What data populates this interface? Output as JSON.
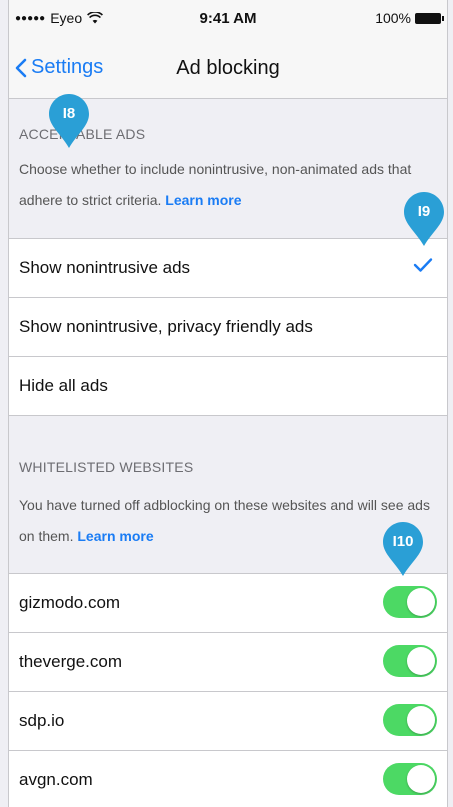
{
  "status_bar": {
    "carrier": "Eyeo",
    "time": "9:41 AM",
    "battery": "100%"
  },
  "nav": {
    "back_label": "Settings",
    "title": "Ad blocking"
  },
  "acceptable_ads": {
    "header": "ACCEPTABLE ADS",
    "description": "Choose whether to include nonintrusive, non-animated ads that adhere to strict criteria.",
    "learn_more": "Learn more",
    "options": [
      {
        "label": "Show nonintrusive ads",
        "selected": true
      },
      {
        "label": "Show nonintrusive, privacy friendly ads",
        "selected": false
      },
      {
        "label": "Hide all ads",
        "selected": false
      }
    ]
  },
  "whitelisted": {
    "header": "WHITELISTED WEBSITES",
    "description": "You have turned off adblocking on these websites and will see ads on them.",
    "learn_more": "Learn more",
    "sites": [
      {
        "domain": "gizmodo.com",
        "enabled": true
      },
      {
        "domain": "theverge.com",
        "enabled": true
      },
      {
        "domain": "sdp.io",
        "enabled": true
      },
      {
        "domain": "avgn.com",
        "enabled": true
      }
    ]
  },
  "annotations": [
    "I8",
    "I9",
    "I10"
  ],
  "colors": {
    "accent": "#1a7cf4",
    "toggle_on": "#4cd964",
    "pin": "#2a9fd6",
    "background": "#efeff4"
  }
}
